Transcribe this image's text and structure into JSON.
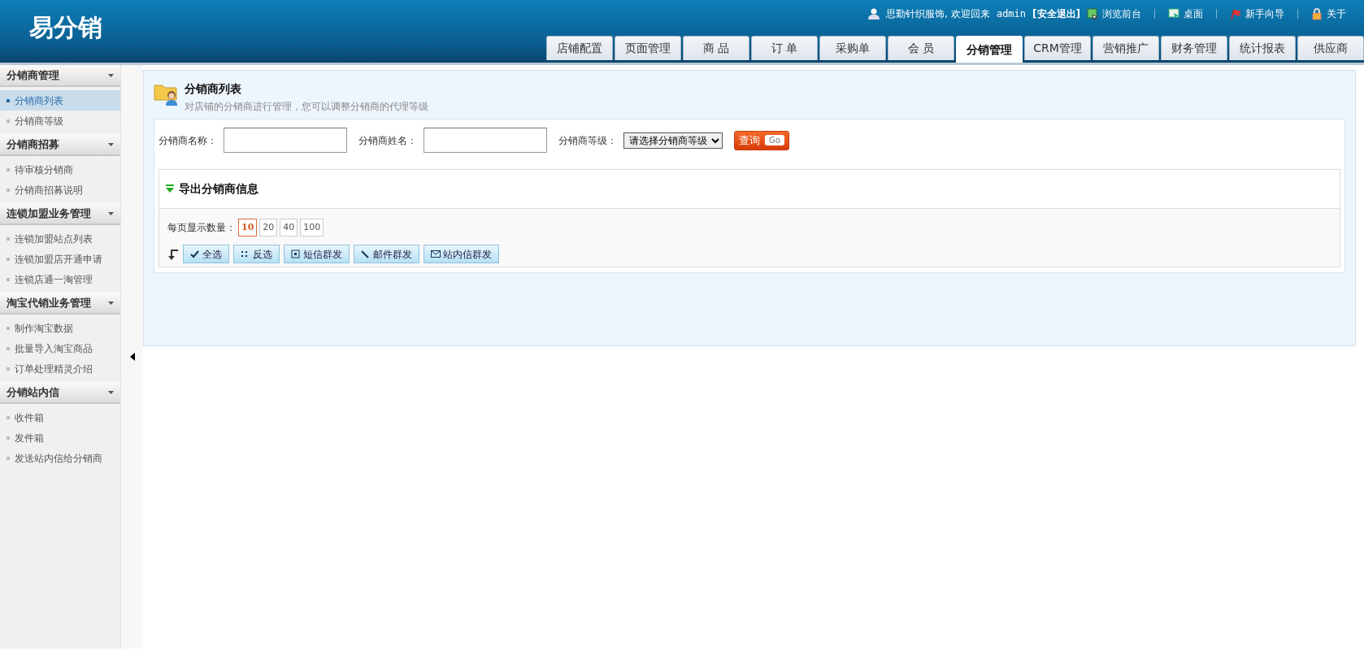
{
  "header": {
    "logo": "易分销",
    "greeting": "思勤针织服饰, 欢迎回来",
    "username": "admin",
    "logout": "[安全退出]",
    "links": [
      {
        "label": "浏览前台"
      },
      {
        "label": "桌面"
      },
      {
        "label": "新手向导"
      },
      {
        "label": "关于"
      }
    ]
  },
  "tabs": [
    {
      "label": "店铺配置",
      "selected": false
    },
    {
      "label": "页面管理",
      "selected": false
    },
    {
      "label": "商 品",
      "selected": false
    },
    {
      "label": "订 单",
      "selected": false
    },
    {
      "label": "采购单",
      "selected": false
    },
    {
      "label": "会 员",
      "selected": false
    },
    {
      "label": "分销管理",
      "selected": true
    },
    {
      "label": "CRM管理",
      "selected": false
    },
    {
      "label": "营销推广",
      "selected": false
    },
    {
      "label": "财务管理",
      "selected": false
    },
    {
      "label": "统计报表",
      "selected": false
    },
    {
      "label": "供应商",
      "selected": false
    }
  ],
  "sidebar": [
    {
      "title": "分销商管理",
      "items": [
        {
          "label": "分销商列表",
          "selected": true
        },
        {
          "label": "分销商等级",
          "selected": false
        }
      ]
    },
    {
      "title": "分销商招募",
      "items": [
        {
          "label": "待审核分销商",
          "selected": false
        },
        {
          "label": "分销商招募说明",
          "selected": false
        }
      ]
    },
    {
      "title": "连锁加盟业务管理",
      "items": [
        {
          "label": "连锁加盟站点列表",
          "selected": false
        },
        {
          "label": "连锁加盟店开通申请",
          "selected": false
        },
        {
          "label": "连锁店通一淘管理",
          "selected": false
        }
      ]
    },
    {
      "title": "淘宝代销业务管理",
      "items": [
        {
          "label": "制作淘宝数据",
          "selected": false
        },
        {
          "label": "批量导入淘宝商品",
          "selected": false
        },
        {
          "label": "订单处理精灵介绍",
          "selected": false
        }
      ]
    },
    {
      "title": "分销站内信",
      "items": [
        {
          "label": "收件箱",
          "selected": false
        },
        {
          "label": "发件箱",
          "selected": false
        },
        {
          "label": "发送站内信给分销商",
          "selected": false
        }
      ]
    }
  ],
  "page": {
    "title": "分销商列表",
    "subtitle": "对店铺的分销商进行管理，您可以调整分销商的代理等级",
    "filters": [
      {
        "kind": "text",
        "label": "分销商名称："
      },
      {
        "kind": "text",
        "label": "分销商姓名："
      },
      {
        "kind": "select",
        "label": "分销商等级：",
        "value": "请选择分销商等级"
      }
    ],
    "search_button": {
      "label": "查询",
      "tag": "Go"
    },
    "export_title": "导出分销商信息",
    "page_size": {
      "label": "每页显示数量：",
      "options": [
        {
          "label": "10",
          "selected": true
        },
        {
          "label": "20",
          "selected": false
        },
        {
          "label": "40",
          "selected": false
        },
        {
          "label": "100",
          "selected": false
        }
      ]
    },
    "actions": [
      {
        "label": "全选"
      },
      {
        "label": "反选"
      },
      {
        "label": "短信群发"
      },
      {
        "label": "邮件群发"
      },
      {
        "label": "站内信群发"
      }
    ]
  }
}
